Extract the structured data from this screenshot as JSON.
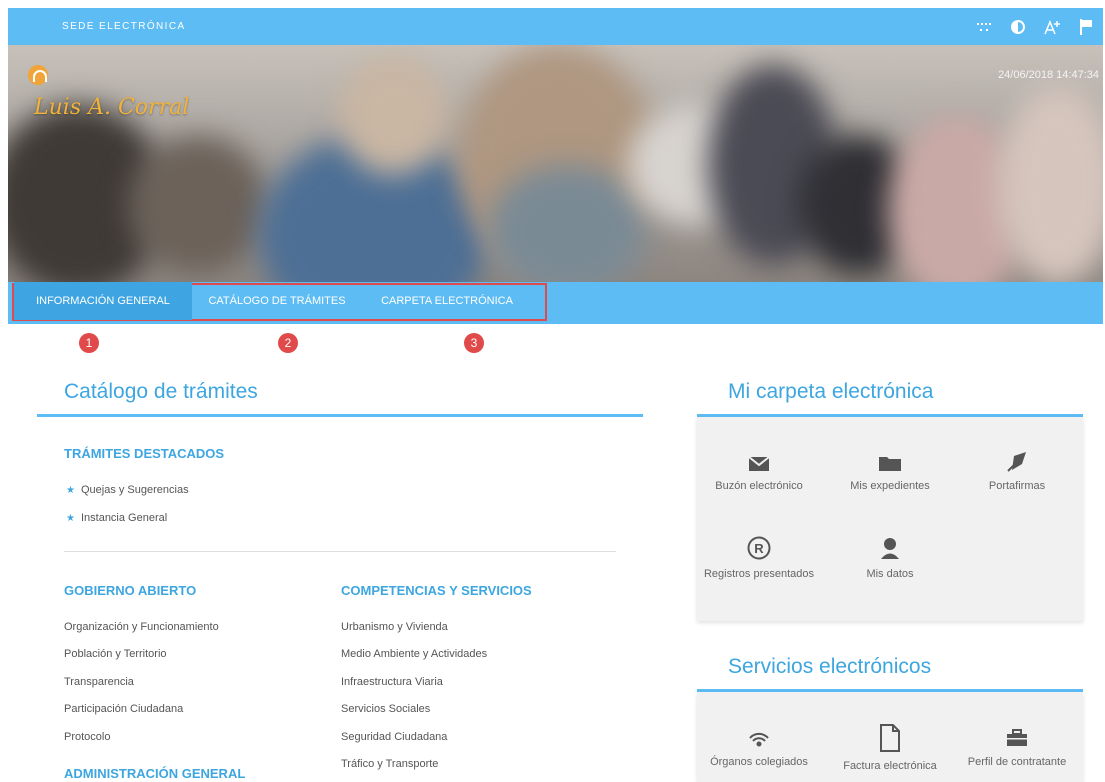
{
  "header": {
    "site_title": "SEDE ELECTRÓNICA"
  },
  "toolbar": [
    "sitemap-icon",
    "contrast-icon",
    "font-size-icon",
    "flag-icon"
  ],
  "hero": {
    "logo_text": "Luis A. Corral",
    "datetime": "24/06/2018 14:47:34"
  },
  "nav": {
    "items": [
      {
        "label": "INFORMACIÓN GENERAL",
        "badge": "1"
      },
      {
        "label": "CATÁLOGO DE TRÁMITES",
        "badge": "2"
      },
      {
        "label": "CARPETA ELECTRÓNICA",
        "badge": "3"
      }
    ]
  },
  "catalog": {
    "title": "Catálogo de trámites",
    "featured_title": "TRÁMITES DESTACADOS",
    "featured": [
      "Quejas y Sugerencias",
      "Instancia General"
    ],
    "col1_title": "GOBIERNO ABIERTO",
    "col1": [
      "Organización y Funcionamiento",
      "Población y Territorio",
      "Transparencia",
      "Participación Ciudadana",
      "Protocolo"
    ],
    "col1_next_title": "ADMINISTRACIÓN GENERAL",
    "col2_title": "COMPETENCIAS Y SERVICIOS",
    "col2": [
      "Urbanismo y Vivienda",
      "Medio Ambiente y Actividades",
      "Infraestructura Viaria",
      "Servicios Sociales",
      "Seguridad Ciudadana",
      "Tráfico y Transporte"
    ]
  },
  "carpeta": {
    "title": "Mi carpeta electrónica",
    "items": [
      {
        "icon": "envelope-icon",
        "label": "Buzón electrónico"
      },
      {
        "icon": "folder-icon",
        "label": "Mis expedientes"
      },
      {
        "icon": "signature-icon",
        "label": "Portafirmas"
      },
      {
        "icon": "registered-icon",
        "label": "Registros presentados"
      },
      {
        "icon": "user-icon",
        "label": "Mis datos"
      }
    ]
  },
  "servicios": {
    "title": "Servicios electrónicos",
    "items": [
      {
        "icon": "broadcast-icon",
        "label": "Órganos colegiados"
      },
      {
        "icon": "document-icon",
        "label": "Factura electrónica"
      },
      {
        "icon": "briefcase-icon",
        "label": "Perfil de contratante"
      }
    ]
  },
  "colors": {
    "accent": "#5dbcf3",
    "accent_dark": "#3ea4e2",
    "title": "#3da6e0",
    "highlight": "#e04a4a",
    "logo": "#f2b23a"
  }
}
